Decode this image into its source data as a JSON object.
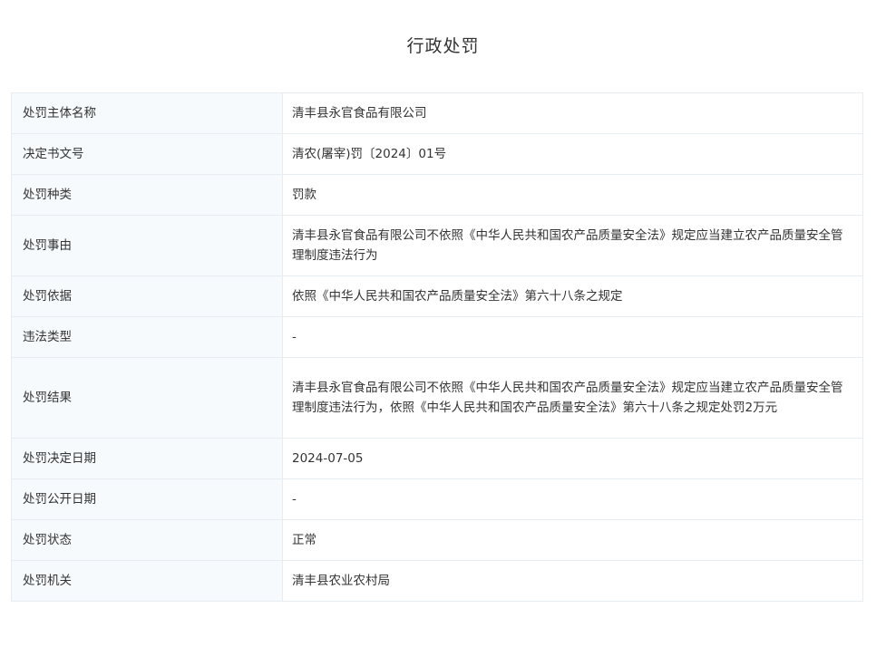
{
  "page_title": "行政处罚",
  "rows": [
    {
      "label": "处罚主体名称",
      "value": "清丰县永官食品有限公司"
    },
    {
      "label": "决定书文号",
      "value": "清农(屠宰)罚〔2024〕01号"
    },
    {
      "label": "处罚种类",
      "value": "罚款"
    },
    {
      "label": "处罚事由",
      "value": "清丰县永官食品有限公司不依照《中华人民共和国农产品质量安全法》规定应当建立农产品质量安全管理制度违法行为"
    },
    {
      "label": "处罚依据",
      "value": "依照《中华人民共和国农产品质量安全法》第六十八条之规定"
    },
    {
      "label": "违法类型",
      "value": "-"
    },
    {
      "label": "处罚结果",
      "value": "清丰县永官食品有限公司不依照《中华人民共和国农产品质量安全法》规定应当建立农产品质量安全管理制度违法行为，依照《中华人民共和国农产品质量安全法》第六十八条之规定处罚2万元"
    },
    {
      "label": "处罚决定日期",
      "value": "2024-07-05"
    },
    {
      "label": "处罚公开日期",
      "value": "-"
    },
    {
      "label": "处罚状态",
      "value": "正常"
    },
    {
      "label": "处罚机关",
      "value": "清丰县农业农村局"
    }
  ]
}
